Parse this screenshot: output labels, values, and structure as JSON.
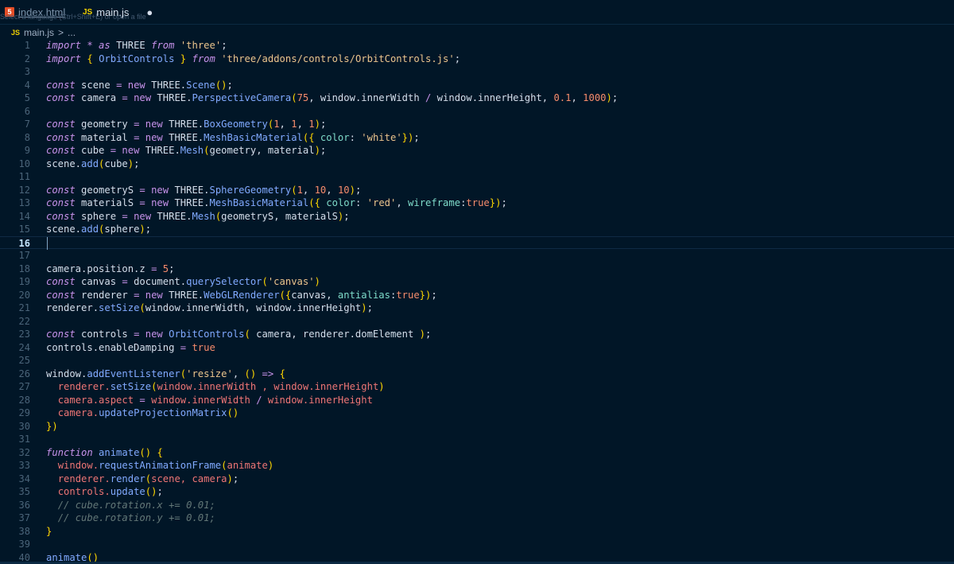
{
  "tabs": [
    {
      "label": "index.html",
      "icon": "html5-icon",
      "active": false
    },
    {
      "label": "main.js",
      "icon": "js-icon",
      "active": true,
      "modified_marker": "●"
    }
  ],
  "tab_hint": "Select a language (Ctrl+Shift+E) or open a file",
  "breadcrumb": {
    "file": "main.js",
    "separator": ">",
    "more": "..."
  },
  "colors": {
    "background": "#011627",
    "keyword": "#c792ea",
    "string": "#ecc48d",
    "function": "#82aaff",
    "number": "#f78c6c",
    "property": "#7fdbca",
    "variable": "#d6deeb",
    "comment": "#637777",
    "punct": "#c792ea",
    "bracket": "#ffd700"
  },
  "current_line": 16,
  "lines": [
    {
      "n": "1",
      "t": [
        [
          "kw",
          "import"
        ],
        [
          "op",
          " * "
        ],
        [
          "kw",
          "as"
        ],
        [
          "pl",
          " THREE "
        ],
        [
          "kw",
          "from"
        ],
        [
          "pl",
          " "
        ],
        [
          "st",
          "'three'"
        ],
        [
          "pl",
          ";"
        ]
      ]
    },
    {
      "n": "2",
      "t": [
        [
          "kw",
          "import"
        ],
        [
          "pl",
          " "
        ],
        [
          "br",
          "{"
        ],
        [
          "pl",
          " "
        ],
        [
          "cl",
          "OrbitControls"
        ],
        [
          "pl",
          " "
        ],
        [
          "br",
          "}"
        ],
        [
          "pl",
          " "
        ],
        [
          "kw",
          "from"
        ],
        [
          "pl",
          " "
        ],
        [
          "st",
          "'three/addons/controls/OrbitControls.js'"
        ],
        [
          "pl",
          ";"
        ]
      ]
    },
    {
      "n": "3",
      "t": []
    },
    {
      "n": "4",
      "t": [
        [
          "kw",
          "const"
        ],
        [
          "pl",
          " scene "
        ],
        [
          "op",
          "="
        ],
        [
          "pl",
          " "
        ],
        [
          "kw",
          "new"
        ],
        [
          "pl",
          " THREE."
        ],
        [
          "fn",
          "Scene"
        ],
        [
          "br",
          "()"
        ],
        [
          "pl",
          ";"
        ]
      ]
    },
    {
      "n": "5",
      "t": [
        [
          "kw",
          "const"
        ],
        [
          "pl",
          " camera "
        ],
        [
          "op",
          "="
        ],
        [
          "pl",
          " "
        ],
        [
          "kw",
          "new"
        ],
        [
          "pl",
          " THREE."
        ],
        [
          "fn",
          "PerspectiveCamera"
        ],
        [
          "br",
          "("
        ],
        [
          "nm",
          "75"
        ],
        [
          "pl",
          ", window.innerWidth "
        ],
        [
          "op",
          "/"
        ],
        [
          "pl",
          " window.innerHeight, "
        ],
        [
          "nm",
          "0.1"
        ],
        [
          "pl",
          ", "
        ],
        [
          "nm",
          "1000"
        ],
        [
          "br",
          ")"
        ],
        [
          "pl",
          ";"
        ]
      ]
    },
    {
      "n": "6",
      "t": []
    },
    {
      "n": "7",
      "t": [
        [
          "kw",
          "const"
        ],
        [
          "pl",
          " geometry "
        ],
        [
          "op",
          "="
        ],
        [
          "pl",
          " "
        ],
        [
          "kw",
          "new"
        ],
        [
          "pl",
          " THREE."
        ],
        [
          "fn",
          "BoxGeometry"
        ],
        [
          "br",
          "("
        ],
        [
          "nm",
          "1"
        ],
        [
          "pl",
          ", "
        ],
        [
          "nm",
          "1"
        ],
        [
          "pl",
          ", "
        ],
        [
          "nm",
          "1"
        ],
        [
          "br",
          ")"
        ],
        [
          "pl",
          ";"
        ]
      ]
    },
    {
      "n": "8",
      "t": [
        [
          "kw",
          "const"
        ],
        [
          "pl",
          " material "
        ],
        [
          "op",
          "="
        ],
        [
          "pl",
          " "
        ],
        [
          "kw",
          "new"
        ],
        [
          "pl",
          " THREE."
        ],
        [
          "fn",
          "MeshBasicMaterial"
        ],
        [
          "br",
          "({"
        ],
        [
          "pl",
          " "
        ],
        [
          "pr",
          "color"
        ],
        [
          "pl",
          ": "
        ],
        [
          "st",
          "'white'"
        ],
        [
          "br",
          "})"
        ],
        [
          "pl",
          ";"
        ]
      ]
    },
    {
      "n": "9",
      "t": [
        [
          "kw",
          "const"
        ],
        [
          "pl",
          " cube "
        ],
        [
          "op",
          "="
        ],
        [
          "pl",
          " "
        ],
        [
          "kw",
          "new"
        ],
        [
          "pl",
          " THREE."
        ],
        [
          "fn",
          "Mesh"
        ],
        [
          "br",
          "("
        ],
        [
          "pl",
          "geometry, material"
        ],
        [
          "br",
          ")"
        ],
        [
          "pl",
          ";"
        ]
      ]
    },
    {
      "n": "10",
      "t": [
        [
          "pl",
          "scene."
        ],
        [
          "fn",
          "add"
        ],
        [
          "br",
          "("
        ],
        [
          "pl",
          "cube"
        ],
        [
          "br",
          ")"
        ],
        [
          "pl",
          ";"
        ]
      ]
    },
    {
      "n": "11",
      "t": []
    },
    {
      "n": "12",
      "t": [
        [
          "kw",
          "const"
        ],
        [
          "pl",
          " geometryS "
        ],
        [
          "op",
          "="
        ],
        [
          "pl",
          " "
        ],
        [
          "kw",
          "new"
        ],
        [
          "pl",
          " THREE."
        ],
        [
          "fn",
          "SphereGeometry"
        ],
        [
          "br",
          "("
        ],
        [
          "nm",
          "1"
        ],
        [
          "pl",
          ", "
        ],
        [
          "nm",
          "10"
        ],
        [
          "pl",
          ", "
        ],
        [
          "nm",
          "10"
        ],
        [
          "br",
          ")"
        ],
        [
          "pl",
          ";"
        ]
      ]
    },
    {
      "n": "13",
      "t": [
        [
          "kw",
          "const"
        ],
        [
          "pl",
          " materialS "
        ],
        [
          "op",
          "="
        ],
        [
          "pl",
          " "
        ],
        [
          "kw",
          "new"
        ],
        [
          "pl",
          " THREE."
        ],
        [
          "fn",
          "MeshBasicMaterial"
        ],
        [
          "br",
          "({"
        ],
        [
          "pl",
          " "
        ],
        [
          "pr",
          "color"
        ],
        [
          "pl",
          ": "
        ],
        [
          "st",
          "'red'"
        ],
        [
          "pl",
          ", "
        ],
        [
          "pr",
          "wireframe"
        ],
        [
          "pl",
          ":"
        ],
        [
          "nm",
          "true"
        ],
        [
          "br",
          "})"
        ],
        [
          "pl",
          ";"
        ]
      ]
    },
    {
      "n": "14",
      "t": [
        [
          "kw",
          "const"
        ],
        [
          "pl",
          " sphere "
        ],
        [
          "op",
          "="
        ],
        [
          "pl",
          " "
        ],
        [
          "kw",
          "new"
        ],
        [
          "pl",
          " THREE."
        ],
        [
          "fn",
          "Mesh"
        ],
        [
          "br",
          "("
        ],
        [
          "pl",
          "geometryS, materialS"
        ],
        [
          "br",
          ")"
        ],
        [
          "pl",
          ";"
        ]
      ]
    },
    {
      "n": "15",
      "t": [
        [
          "pl",
          "scene."
        ],
        [
          "fn",
          "add"
        ],
        [
          "br",
          "("
        ],
        [
          "pl",
          "sphere"
        ],
        [
          "br",
          ")"
        ],
        [
          "pl",
          ";"
        ]
      ]
    },
    {
      "n": "16",
      "t": []
    },
    {
      "n": "17",
      "t": []
    },
    {
      "n": "18",
      "t": [
        [
          "pl",
          "camera.position.z "
        ],
        [
          "op",
          "="
        ],
        [
          "pl",
          " "
        ],
        [
          "nm",
          "5"
        ],
        [
          "pl",
          ";"
        ]
      ]
    },
    {
      "n": "19",
      "t": [
        [
          "kw",
          "const"
        ],
        [
          "pl",
          " canvas "
        ],
        [
          "op",
          "="
        ],
        [
          "pl",
          " document."
        ],
        [
          "fn",
          "querySelector"
        ],
        [
          "br",
          "("
        ],
        [
          "st",
          "'canvas'"
        ],
        [
          "br",
          ")"
        ]
      ]
    },
    {
      "n": "20",
      "t": [
        [
          "kw",
          "const"
        ],
        [
          "pl",
          " renderer "
        ],
        [
          "op",
          "="
        ],
        [
          "pl",
          " "
        ],
        [
          "kw",
          "new"
        ],
        [
          "pl",
          " THREE."
        ],
        [
          "fn",
          "WebGLRenderer"
        ],
        [
          "br",
          "({"
        ],
        [
          "pl",
          "canvas, "
        ],
        [
          "pr",
          "antialias"
        ],
        [
          "pl",
          ":"
        ],
        [
          "nm",
          "true"
        ],
        [
          "br",
          "})"
        ],
        [
          "pl",
          ";"
        ]
      ]
    },
    {
      "n": "21",
      "t": [
        [
          "pl",
          "renderer."
        ],
        [
          "fn",
          "setSize"
        ],
        [
          "br",
          "("
        ],
        [
          "pl",
          "window.innerWidth, window.innerHeight"
        ],
        [
          "br",
          ")"
        ],
        [
          "pl",
          ";"
        ]
      ]
    },
    {
      "n": "22",
      "t": []
    },
    {
      "n": "23",
      "t": [
        [
          "kw",
          "const"
        ],
        [
          "pl",
          " controls "
        ],
        [
          "op",
          "="
        ],
        [
          "pl",
          " "
        ],
        [
          "kw",
          "new"
        ],
        [
          "pl",
          " "
        ],
        [
          "fn",
          "OrbitControls"
        ],
        [
          "br",
          "("
        ],
        [
          "pl",
          " camera, renderer.domElement "
        ],
        [
          "br",
          ")"
        ],
        [
          "pl",
          ";"
        ]
      ]
    },
    {
      "n": "24",
      "t": [
        [
          "pl",
          "controls.enableDamping "
        ],
        [
          "op",
          "="
        ],
        [
          "pl",
          " "
        ],
        [
          "nm",
          "true"
        ]
      ]
    },
    {
      "n": "25",
      "t": []
    },
    {
      "n": "26",
      "t": [
        [
          "pl",
          "window."
        ],
        [
          "fn",
          "addEventListener"
        ],
        [
          "br",
          "("
        ],
        [
          "st",
          "'resize'"
        ],
        [
          "pl",
          ", "
        ],
        [
          "br",
          "()"
        ],
        [
          "pl",
          " "
        ],
        [
          "kw",
          "=>"
        ],
        [
          "pl",
          " "
        ],
        [
          "br",
          "{"
        ]
      ]
    },
    {
      "n": "27",
      "t": [
        [
          "pl",
          "  "
        ],
        [
          "rd",
          "renderer."
        ],
        [
          "fn",
          "setSize"
        ],
        [
          "br",
          "("
        ],
        [
          "rd",
          "window.innerWidth , window.innerHeight"
        ],
        [
          "br",
          ")"
        ]
      ]
    },
    {
      "n": "28",
      "t": [
        [
          "pl",
          "  "
        ],
        [
          "rd",
          "camera.aspect "
        ],
        [
          "op",
          "="
        ],
        [
          "rd",
          " window.innerWidth "
        ],
        [
          "op",
          "/"
        ],
        [
          "rd",
          " window.innerHeight"
        ]
      ]
    },
    {
      "n": "29",
      "t": [
        [
          "pl",
          "  "
        ],
        [
          "rd",
          "camera."
        ],
        [
          "fn",
          "updateProjectionMatrix"
        ],
        [
          "br",
          "()"
        ]
      ]
    },
    {
      "n": "30",
      "t": [
        [
          "br",
          "})"
        ]
      ]
    },
    {
      "n": "31",
      "t": []
    },
    {
      "n": "32",
      "t": [
        [
          "kw",
          "function"
        ],
        [
          "pl",
          " "
        ],
        [
          "fn",
          "animate"
        ],
        [
          "br",
          "()"
        ],
        [
          "pl",
          " "
        ],
        [
          "br",
          "{"
        ]
      ]
    },
    {
      "n": "33",
      "t": [
        [
          "pl",
          "  "
        ],
        [
          "rd",
          "window."
        ],
        [
          "fn",
          "requestAnimationFrame"
        ],
        [
          "br",
          "("
        ],
        [
          "rd",
          "animate"
        ],
        [
          "br",
          ")"
        ]
      ]
    },
    {
      "n": "34",
      "t": [
        [
          "pl",
          "  "
        ],
        [
          "rd",
          "renderer."
        ],
        [
          "fn",
          "render"
        ],
        [
          "br",
          "("
        ],
        [
          "rd",
          "scene, camera"
        ],
        [
          "br",
          ")"
        ],
        [
          "pl",
          ";"
        ]
      ]
    },
    {
      "n": "35",
      "t": [
        [
          "pl",
          "  "
        ],
        [
          "rd",
          "controls."
        ],
        [
          "fn",
          "update"
        ],
        [
          "br",
          "()"
        ],
        [
          "pl",
          ";"
        ]
      ]
    },
    {
      "n": "36",
      "t": [
        [
          "pl",
          "  "
        ],
        [
          "cm",
          "// cube.rotation.x += 0.01;"
        ]
      ]
    },
    {
      "n": "37",
      "t": [
        [
          "pl",
          "  "
        ],
        [
          "cm",
          "// cube.rotation.y += 0.01;"
        ]
      ]
    },
    {
      "n": "38",
      "t": [
        [
          "br",
          "}"
        ]
      ]
    },
    {
      "n": "39",
      "t": []
    },
    {
      "n": "40",
      "t": [
        [
          "fn",
          "animate"
        ],
        [
          "br",
          "()"
        ]
      ]
    }
  ]
}
